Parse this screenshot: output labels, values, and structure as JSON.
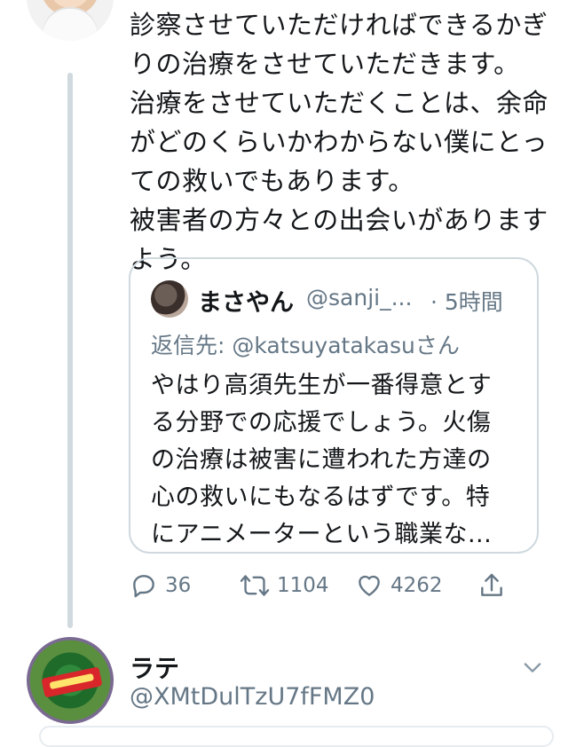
{
  "tweet": {
    "lines": [
      "診察させていただければできるかぎ",
      "りの治療をさせていただきます。",
      "治療をさせていただくことは、余命",
      "がどのくらいかわからない僕にとっ",
      "ての救いでもあります。",
      "被害者の方々との出会いがあります",
      "よう。"
    ]
  },
  "quote": {
    "name": "まさやん",
    "handle": "@sanji_...",
    "time": "· 5時間",
    "reply_prefix": "返信先: ",
    "reply_mention": "@katsuyatakasu",
    "reply_suffix": "さん",
    "lines": [
      "やはり高須先生が一番得意とす",
      "る分野での応援でしょう。火傷",
      "の治療は被害に遭われた方達の",
      "心の救いにもなるはずです。特",
      "にアニメーターという職業な..."
    ]
  },
  "actions": {
    "reply_count": "36",
    "retweet_count": "1104",
    "like_count": "4262"
  },
  "next_tweet": {
    "name": "ラテ",
    "handle": "@XMtDulTzU7fFMZ0"
  },
  "icons": {
    "reply": "reply-icon",
    "retweet": "retweet-icon",
    "like": "heart-icon",
    "share": "share-icon",
    "more": "chevron-down-icon"
  },
  "colors": {
    "text": "#14171a",
    "secondary": "#657786",
    "border": "#cfd9de"
  }
}
